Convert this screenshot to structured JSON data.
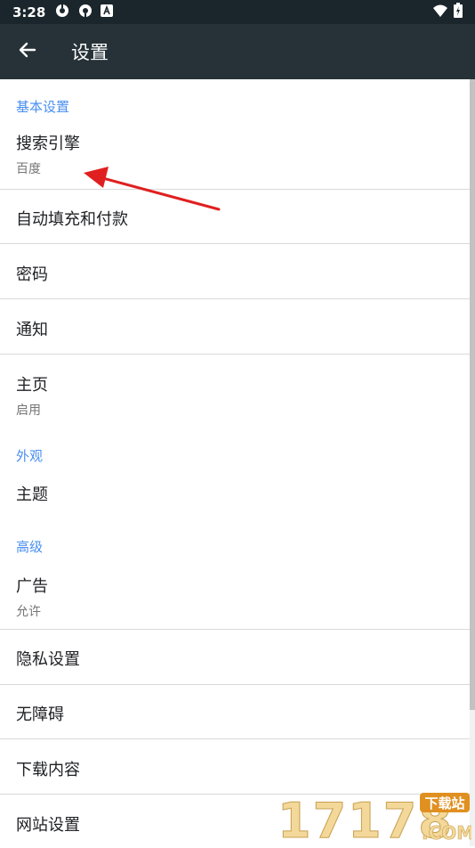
{
  "status_bar": {
    "time": "3:28",
    "left_icons": [
      "sync-icon",
      "sync-icon",
      "a-badge-icon"
    ],
    "right_icons": [
      "wifi-icon",
      "battery-charging-icon"
    ]
  },
  "toolbar": {
    "back_icon": "arrow-left-icon",
    "title": "设置"
  },
  "sections": {
    "basic": {
      "header": "基本设置",
      "items": [
        {
          "title": "搜索引擎",
          "subtitle": "百度"
        },
        {
          "title": "自动填充和付款"
        },
        {
          "title": "密码"
        },
        {
          "title": "通知"
        },
        {
          "title": "主页",
          "subtitle": "启用"
        }
      ]
    },
    "appearance": {
      "header": "外观",
      "items": [
        {
          "title": "主题"
        }
      ]
    },
    "advanced": {
      "header": "高级",
      "items": [
        {
          "title": "广告",
          "subtitle": "允许"
        },
        {
          "title": "隐私设置"
        },
        {
          "title": "无障碍"
        },
        {
          "title": "下载内容"
        },
        {
          "title": "网站设置"
        }
      ]
    }
  },
  "watermark": {
    "number": "17178",
    "tag": "下载站",
    "domain": ".COM"
  },
  "colors": {
    "status_bar": "#1b262c",
    "toolbar": "#263238",
    "section_header": "#4a8ff0",
    "annotation_arrow": "#e02020"
  }
}
